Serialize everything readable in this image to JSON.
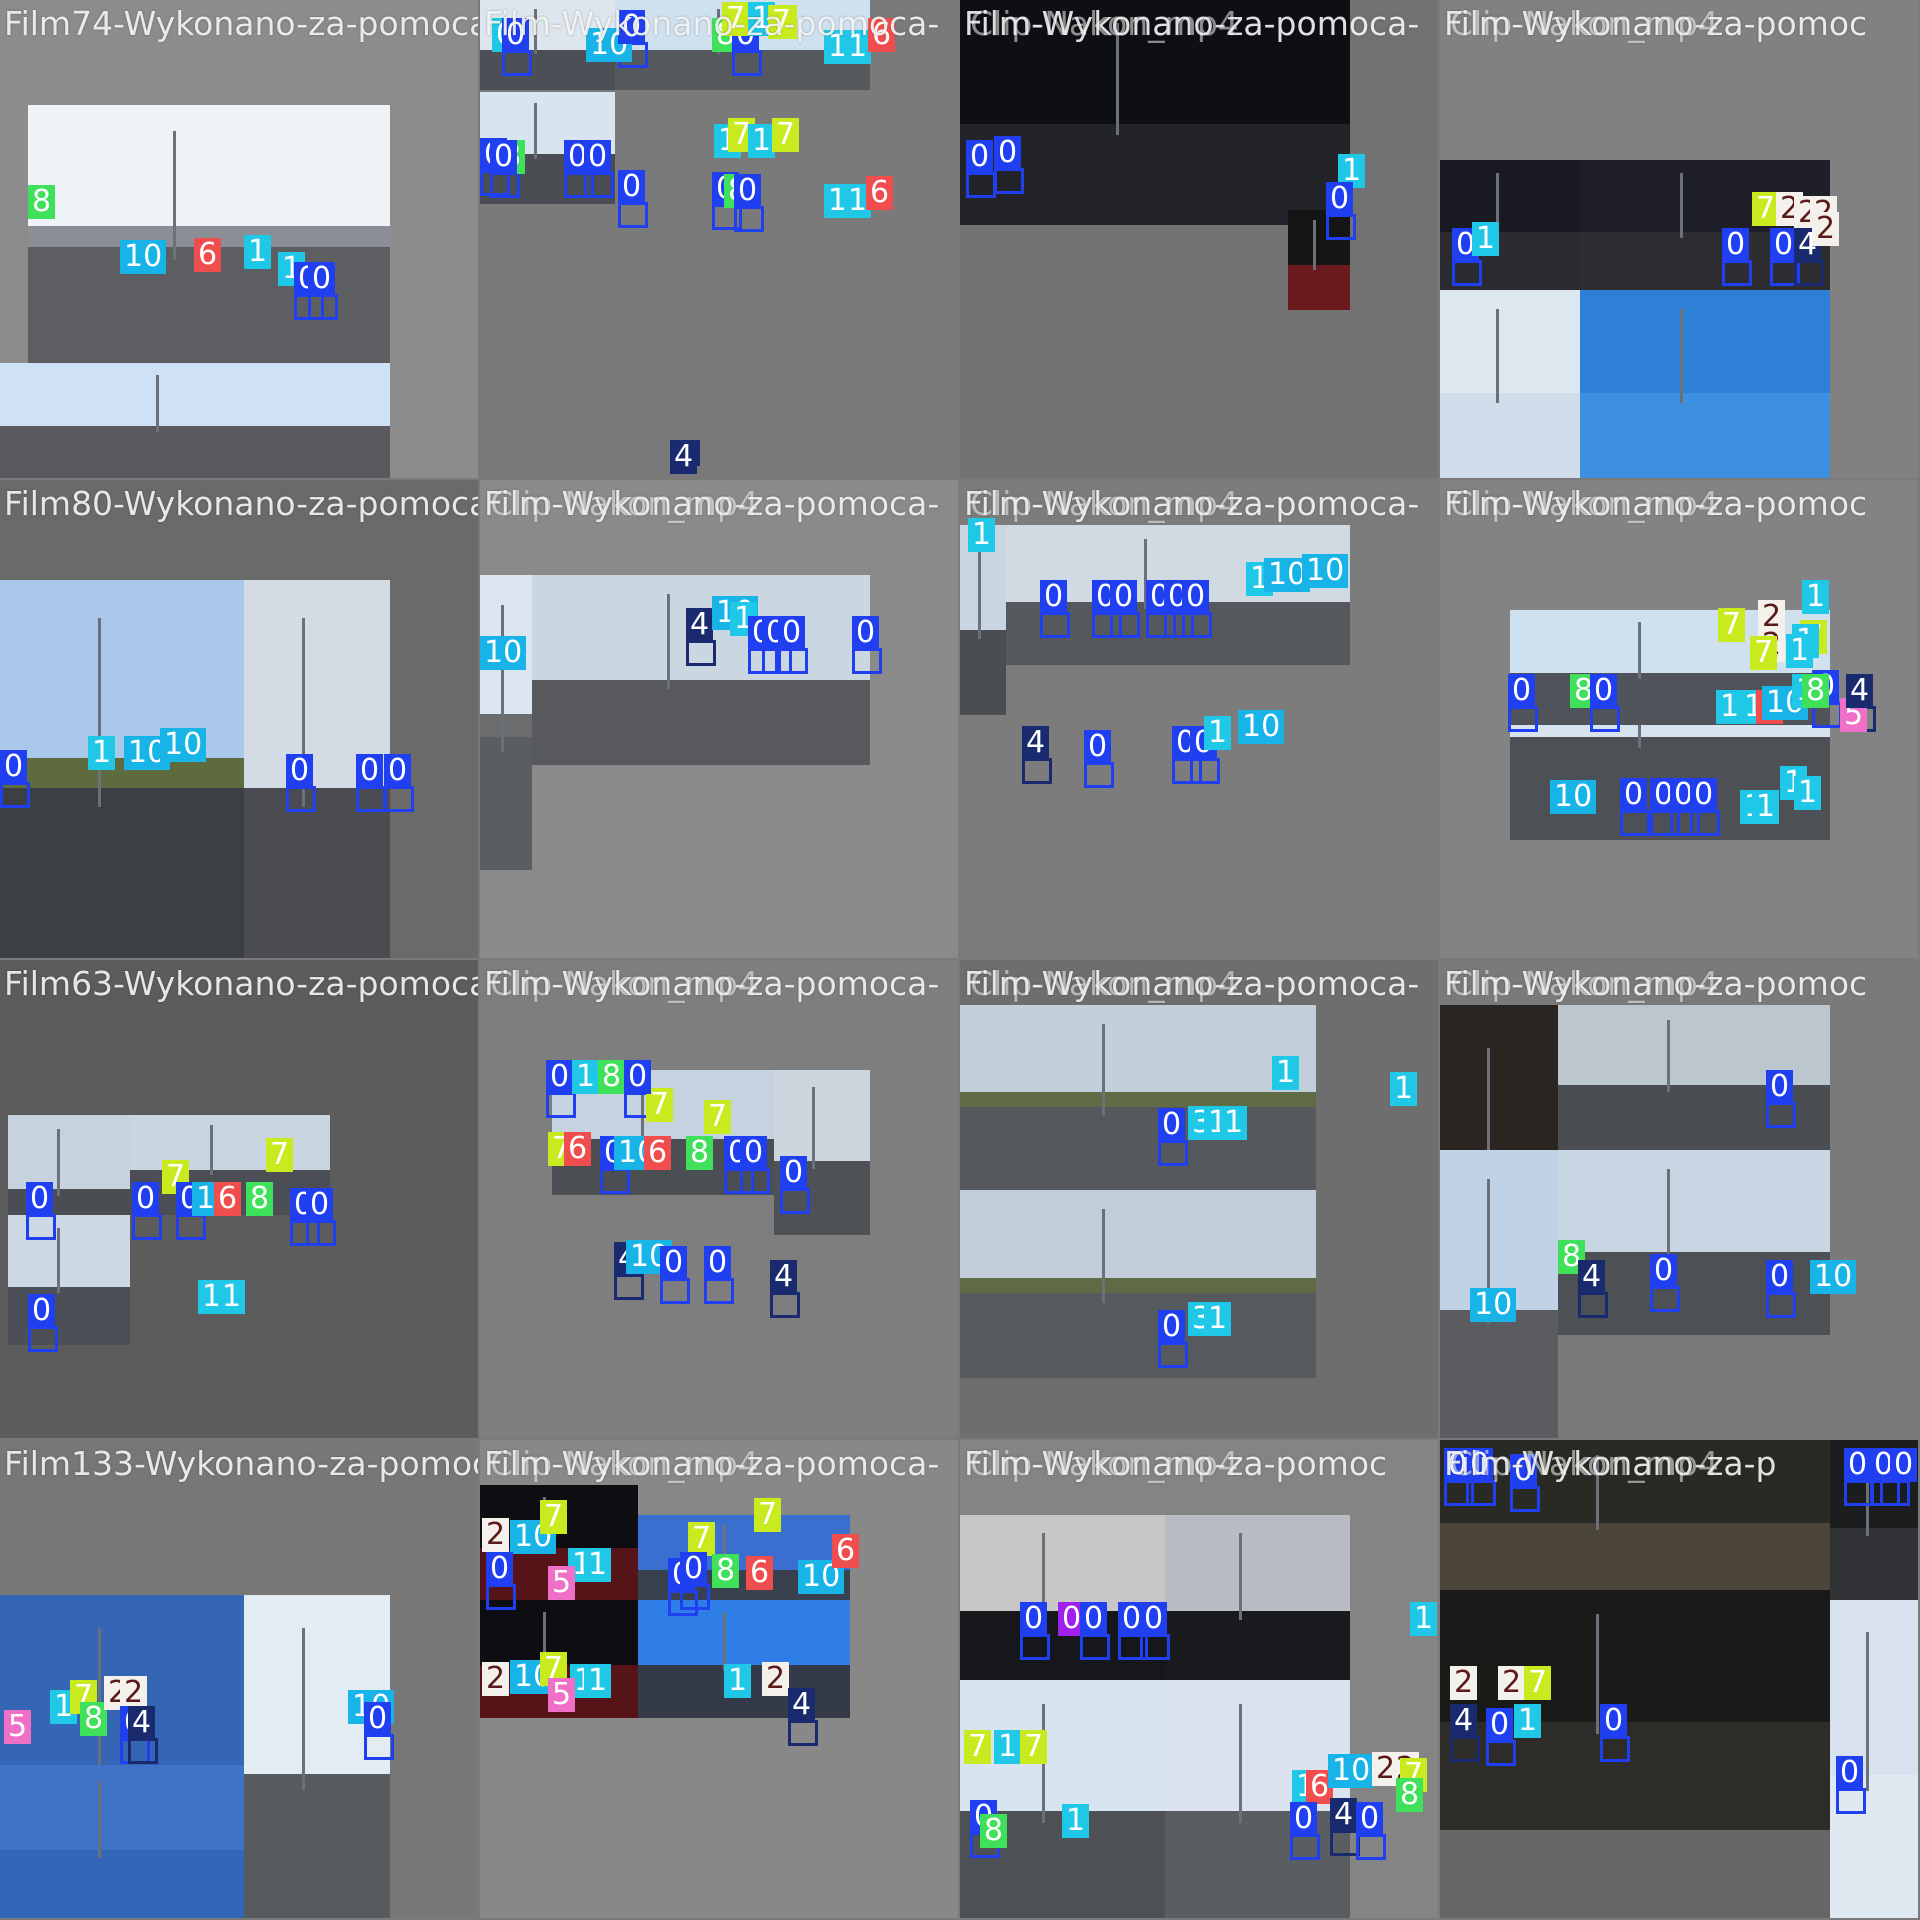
{
  "tiles": [
    {
      "titles": [
        "Film74-Wykonano-za-pomoca-"
      ],
      "bg": "#8c8c8c",
      "photos": [
        {
          "sky": "#eef3f8",
          "road": "#5c5e62",
          "veg": "#8a8f96"
        },
        {
          "sky": "#cfe2f5",
          "road": "#5a5a5e"
        }
      ],
      "labels": [
        "8",
        "10",
        "6",
        "1",
        "1",
        "0",
        "0"
      ],
      "label_colors": [
        "#3fe05a",
        "#18b4e8",
        "#f04e4e",
        "#1ec8e6",
        "#1ec8e6",
        "#1f3ff0",
        "#1f3ff0"
      ]
    },
    {
      "titles": [
        "Film-Wykonano-za-pomoca-"
      ],
      "bg": "#7a7a7a",
      "photos": [
        {
          "sky": "#dde6ee",
          "road": "#4c4f55"
        },
        {
          "sky": "#cfe0ef",
          "road": "#55585d"
        },
        {
          "sky": "#d9e5ee",
          "road": "#4a4d52"
        }
      ],
      "labels": [
        "0",
        "0",
        "10",
        "0",
        "8",
        "0",
        "7",
        "1",
        "7",
        "1",
        "1",
        "6",
        "7",
        "0",
        "8",
        "0",
        "0",
        "0",
        "1",
        "7",
        "1",
        "7",
        "0",
        "0",
        "8",
        "0",
        "1",
        "1",
        "6",
        "4"
      ],
      "label_colors": [
        "#1ec8e6",
        "#1f3ff0",
        "#18b4e8",
        "#1f3ff0",
        "#3fe05a",
        "#1f3ff0",
        "#c8ea1e",
        "#1ec8e6",
        "#c8ea1e",
        "#1ec8e6",
        "#1ec8e6",
        "#f04e4e",
        "#c8ea1e",
        "#1f3ff0",
        "#3fe05a",
        "#1f3ff0",
        "#1f3ff0",
        "#1f3ff0",
        "#1ec8e6",
        "#c8ea1e",
        "#1ec8e6",
        "#c8ea1e",
        "#1f3ff0",
        "#1f3ff0",
        "#3fe05a",
        "#1f3ff0",
        "#1ec8e6",
        "#1ec8e6",
        "#f04e4e",
        "#1a2a6e"
      ]
    },
    {
      "titles": [
        "Film-Wykonano-za-pomoca-",
        "Clip-Nakon_mp4"
      ],
      "bg": "#727272",
      "photos": [
        {
          "sky": "#0d0f14",
          "road": "#22242a"
        },
        {
          "sky": "#151515",
          "road": "#6a1a1c"
        }
      ],
      "labels": [
        "0",
        "0",
        "1",
        "0"
      ],
      "label_colors": [
        "#1f3ff0",
        "#1f3ff0",
        "#1ec8e6",
        "#1f3ff0"
      ]
    },
    {
      "titles": [
        "Film-Wykonano-za-pomoc",
        "Clip-Nakon_mp4"
      ],
      "bg": "#818181",
      "photos": [
        {
          "sky": "#1a1b22",
          "road": "#2a2b30"
        },
        {
          "sky": "#1e1f28",
          "road": "#2c2c31"
        },
        {
          "sky": "#dde7f0",
          "road": "#cfdcea"
        },
        {
          "sky": "#2e7fd6",
          "road": "#3f8fe0"
        }
      ],
      "labels": [
        "0",
        "1",
        "0",
        "7",
        "2",
        "2",
        "2",
        "0",
        "4",
        "2"
      ],
      "label_colors": [
        "#1f3ff0",
        "#1ec8e6",
        "#1f3ff0",
        "#c8ea1e",
        "#f4f0ec",
        "#f4f0ec",
        "#f4f0ec",
        "#1f3ff0",
        "#1a2a6e",
        "#f4f0ec"
      ]
    },
    {
      "titles": [
        "Film80-Wykonano-za-pomoca-"
      ],
      "bg": "#6a6a6a",
      "photos": [
        {
          "sky": "#aac8ea",
          "road": "#3c3f44",
          "veg": "#5e6b3e"
        },
        {
          "sky": "#d3dbe4",
          "road": "#4a4c51"
        }
      ],
      "labels": [
        "0",
        "1",
        "10",
        "10",
        "0",
        "0",
        "0"
      ],
      "label_colors": [
        "#1f3ff0",
        "#1ec8e6",
        "#18b4e8",
        "#18b4e8",
        "#1f3ff0",
        "#1f3ff0",
        "#1f3ff0"
      ]
    },
    {
      "titles": [
        "Film-Wykonano-za-pomoca-",
        "Clip-Nakon_mp4"
      ],
      "bg": "#8a8a8a",
      "photos": [
        {
          "sky": "#dbe6f0",
          "road": "#5a5d62",
          "veg": "#6a6c6e"
        },
        {
          "sky": "#cad6e0",
          "road": "#57595d"
        }
      ],
      "labels": [
        "10",
        "4",
        "10",
        "1",
        "0",
        "0",
        "0",
        "0"
      ],
      "label_colors": [
        "#18b4e8",
        "#1a2a6e",
        "#18b4e8",
        "#1ec8e6",
        "#1f3ff0",
        "#1f3ff0",
        "#1f3ff0",
        "#1f3ff0"
      ]
    },
    {
      "titles": [
        "Film-Wykonano-za-pomoca-",
        "Clip-Nakon_mp4"
      ],
      "bg": "#7c7c7c",
      "photos": [
        {
          "sky": "#c9d6e2",
          "road": "#4a4d52"
        },
        {
          "sky": "#d0dae3",
          "road": "#55585d"
        }
      ],
      "labels": [
        "1",
        "0",
        "0",
        "0",
        "0",
        "0",
        "0",
        "1",
        "10",
        "10",
        "4",
        "0",
        "0",
        "0",
        "1",
        "10"
      ],
      "label_colors": [
        "#1ec8e6",
        "#1f3ff0",
        "#1f3ff0",
        "#1f3ff0",
        "#1f3ff0",
        "#1f3ff0",
        "#1f3ff0",
        "#1ec8e6",
        "#18b4e8",
        "#18b4e8",
        "#1a2a6e",
        "#1f3ff0",
        "#1f3ff0",
        "#1f3ff0",
        "#1ec8e6",
        "#18b4e8"
      ]
    },
    {
      "titles": [
        "Film-Wykonano-za-pomoc",
        "Clip-Nakon_mp4"
      ],
      "bg": "#838383",
      "photos": [
        {
          "sky": "#d6e2ee",
          "road": "#4d5055"
        },
        {
          "sky": "#cfe0ee",
          "road": "#50535a"
        }
      ],
      "labels": [
        "7",
        "2",
        "2",
        "7",
        "1",
        "7",
        "1",
        "1",
        "0",
        "8",
        "0",
        "1",
        "1",
        "6",
        "10",
        "1",
        "0",
        "8",
        "5",
        "4",
        "10",
        "1",
        "1",
        "0",
        "0",
        "0",
        "0",
        "1",
        "1"
      ],
      "label_colors": [
        "#c8ea1e",
        "#f4f0ec",
        "#f4f0ec",
        "#c8ea1e",
        "#1ec8e6",
        "#c8ea1e",
        "#1ec8e6",
        "#1ec8e6",
        "#1f3ff0",
        "#3fe05a",
        "#1f3ff0",
        "#1ec8e6",
        "#1ec8e6",
        "#f04e4e",
        "#18b4e8",
        "#1ec8e6",
        "#1f3ff0",
        "#3fe05a",
        "#f070c8",
        "#1a2a6e",
        "#18b4e8",
        "#1ec8e6",
        "#1ec8e6",
        "#1f3ff0",
        "#1f3ff0",
        "#1f3ff0",
        "#1f3ff0",
        "#1ec8e6",
        "#1ec8e6"
      ]
    },
    {
      "titles": [
        "Film63-Wykonano-za-pomoca-"
      ],
      "bg": "#5c5c5c",
      "photos": [
        {
          "sky": "#c6d3df",
          "road": "#4a4d52"
        },
        {
          "sky": "#c9d5e1",
          "road": "#4b4e54"
        },
        {
          "sky": "#ccd8e4",
          "road": "#4c4f55"
        }
      ],
      "labels": [
        "0",
        "7",
        "0",
        "0",
        "10",
        "6",
        "8",
        "7",
        "0",
        "0",
        "1",
        "1",
        "0"
      ],
      "label_colors": [
        "#1f3ff0",
        "#c8ea1e",
        "#1f3ff0",
        "#1f3ff0",
        "#18b4e8",
        "#f04e4e",
        "#3fe05a",
        "#c8ea1e",
        "#1f3ff0",
        "#1f3ff0",
        "#1ec8e6",
        "#1ec8e6",
        "#1f3ff0"
      ]
    },
    {
      "titles": [
        "Film-Wykonano-za-pomoca-",
        "Clip-Nakon_mp4"
      ],
      "bg": "#7e7e7e",
      "photos": [
        {
          "sky": "#c5d3e0",
          "road": "#4b4e53"
        },
        {
          "sky": "#cdd6de",
          "road": "#4e5156"
        }
      ],
      "labels": [
        "7",
        "7",
        "6",
        "0",
        "10",
        "6",
        "8",
        "7",
        "0",
        "0",
        "0",
        "4",
        "10",
        "0",
        "0",
        "4",
        "0",
        "1",
        "8",
        "0"
      ],
      "label_colors": [
        "#c8ea1e",
        "#c8ea1e",
        "#f04e4e",
        "#1f3ff0",
        "#18b4e8",
        "#f04e4e",
        "#3fe05a",
        "#c8ea1e",
        "#1f3ff0",
        "#1f3ff0",
        "#1f3ff0",
        "#1a2a6e",
        "#18b4e8",
        "#1f3ff0",
        "#1f3ff0",
        "#1a2a6e",
        "#1f3ff0",
        "#1ec8e6",
        "#3fe05a",
        "#1f3ff0"
      ]
    },
    {
      "titles": [
        "Film-Wykonano-za-pomoca-",
        "Clip-Nakon_mp4"
      ],
      "bg": "#6e6e6e",
      "photos": [
        {
          "sky": "#c3cfdb",
          "road": "#55585c",
          "veg": "#5f6c45"
        },
        {
          "sky": "#c1cdd9",
          "road": "#56595d",
          "veg": "#5e6b44"
        }
      ],
      "labels": [
        "1",
        "1",
        "0",
        "3",
        "1",
        "1",
        "0",
        "3",
        "1"
      ],
      "label_colors": [
        "#1ec8e6",
        "#1ec8e6",
        "#1f3ff0",
        "#1ec8e6",
        "#1ec8e6",
        "#1ec8e6",
        "#1f3ff0",
        "#1ec8e6",
        "#1ec8e6"
      ]
    },
    {
      "titles": [
        "Film-Wykonano-za-pomoc",
        "Clip-Nakon_mp4"
      ],
      "bg": "#7a7a7a",
      "photos": [
        {
          "sky": "#2a2520",
          "road": "#1e1c1a"
        },
        {
          "sky": "#bcc6cf",
          "road": "#4a4d52"
        },
        {
          "sky": "#bfd2e6",
          "road": "#5a5c60"
        },
        {
          "sky": "#c8d6e3",
          "road": "#4d5055"
        }
      ],
      "labels": [
        "0",
        "8",
        "4",
        "0",
        "0",
        "10",
        "10"
      ],
      "label_colors": [
        "#1f3ff0",
        "#3fe05a",
        "#1a2a6e",
        "#1f3ff0",
        "#1f3ff0",
        "#18b4e8",
        "#18b4e8"
      ]
    },
    {
      "titles": [
        "Film133-Wykonano-za-pomoca-"
      ],
      "bg": "#777777",
      "photos": [
        {
          "sky": "#3565b5",
          "road": "#2c2e36"
        },
        {
          "sky": "#e4ecf3",
          "road": "#575a5f"
        },
        {
          "sky": "#3f73c8",
          "road": "#3466b8"
        }
      ],
      "labels": [
        "5",
        "1",
        "7",
        "8",
        "2",
        "2",
        "0",
        "4",
        "10",
        "0"
      ],
      "label_colors": [
        "#f070c8",
        "#1ec8e6",
        "#c8ea1e",
        "#3fe05a",
        "#f4f0ec",
        "#f4f0ec",
        "#1f3ff0",
        "#1a2a6e",
        "#18b4e8",
        "#1f3ff0"
      ]
    },
    {
      "titles": [
        "Film-Wykonano-za-pomoca-",
        "Clip-Nakon_mp4"
      ],
      "bg": "#888888",
      "photos": [
        {
          "sky": "#0e0e12",
          "road": "#571418"
        },
        {
          "sky": "#3a6fd0",
          "road": "#39404e"
        },
        {
          "sky": "#0e0e12",
          "road": "#561418"
        },
        {
          "sky": "#2f7de6",
          "road": "#343a48"
        }
      ],
      "labels": [
        "2",
        "10",
        "7",
        "0",
        "1",
        "1",
        "5",
        "7",
        "7",
        "0",
        "0",
        "8",
        "6",
        "10",
        "6",
        "2",
        "10",
        "7",
        "1",
        "1",
        "5",
        "1",
        "2",
        "4"
      ],
      "label_colors": [
        "#f4f0ec",
        "#18b4e8",
        "#c8ea1e",
        "#1f3ff0",
        "#1ec8e6",
        "#1ec8e6",
        "#f070c8",
        "#c8ea1e",
        "#c8ea1e",
        "#1f3ff0",
        "#1f3ff0",
        "#3fe05a",
        "#f04e4e",
        "#18b4e8",
        "#f04e4e",
        "#f4f0ec",
        "#18b4e8",
        "#c8ea1e",
        "#1ec8e6",
        "#1ec8e6",
        "#f070c8",
        "#1ec8e6",
        "#f4f0ec",
        "#1a2a6e"
      ]
    },
    {
      "titles": [
        "Film-Wykonano-za-pomoc",
        "Clip-Nakon_mp4"
      ],
      "bg": "#848484",
      "photos": [
        {
          "sky": "#c9c6c6",
          "road": "#16171a"
        },
        {
          "sky": "#b9bcc2",
          "road": "#1a1b1f"
        },
        {
          "sky": "#d8e4ef",
          "road": "#4d5055"
        },
        {
          "sky": "#dae3ee",
          "road": "#5a5d62"
        }
      ],
      "labels": [
        "0",
        "0",
        "0",
        "0",
        "0",
        "1",
        "7",
        "1",
        "7",
        "0",
        "8",
        "1",
        "1",
        "6",
        "10",
        "0",
        "4",
        "0",
        "2",
        "2",
        "7",
        "8"
      ],
      "label_colors": [
        "#1f3ff0",
        "#a020f0",
        "#1f3ff0",
        "#1f3ff0",
        "#1f3ff0",
        "#1ec8e6",
        "#c8ea1e",
        "#1ec8e6",
        "#c8ea1e",
        "#1f3ff0",
        "#3fe05a",
        "#1ec8e6",
        "#1ec8e6",
        "#f04e4e",
        "#18b4e8",
        "#1f3ff0",
        "#1a2a6e",
        "#1f3ff0",
        "#f4f0ec",
        "#f4f0ec",
        "#c8ea1e",
        "#3fe05a"
      ]
    },
    {
      "titles": [
        "Film-Wykonano-za-p",
        "Clip-Nakon_mp4"
      ],
      "bg": "#666666",
      "photos": [
        {
          "sky": "#2a2a25",
          "road": "#4a4538"
        },
        {
          "sky": "#1a1a18",
          "road": "#2e2c28"
        },
        {
          "sky": "#1c1d1f",
          "road": "#303236"
        },
        {
          "sky": "#d8e2ee",
          "road": "#e0e8f2"
        }
      ],
      "labels": [
        "0",
        "0",
        "0",
        "0",
        "0",
        "0",
        "2",
        "2",
        "7",
        "4",
        "0",
        "1",
        "0",
        "0"
      ],
      "label_colors": [
        "#1f3ff0",
        "#1f3ff0",
        "#1f3ff0",
        "#1f3ff0",
        "#1f3ff0",
        "#1f3ff0",
        "#f4f0ec",
        "#f4f0ec",
        "#c8ea1e",
        "#1a2a6e",
        "#1f3ff0",
        "#1ec8e6",
        "#1f3ff0",
        "#1f3ff0"
      ]
    }
  ]
}
